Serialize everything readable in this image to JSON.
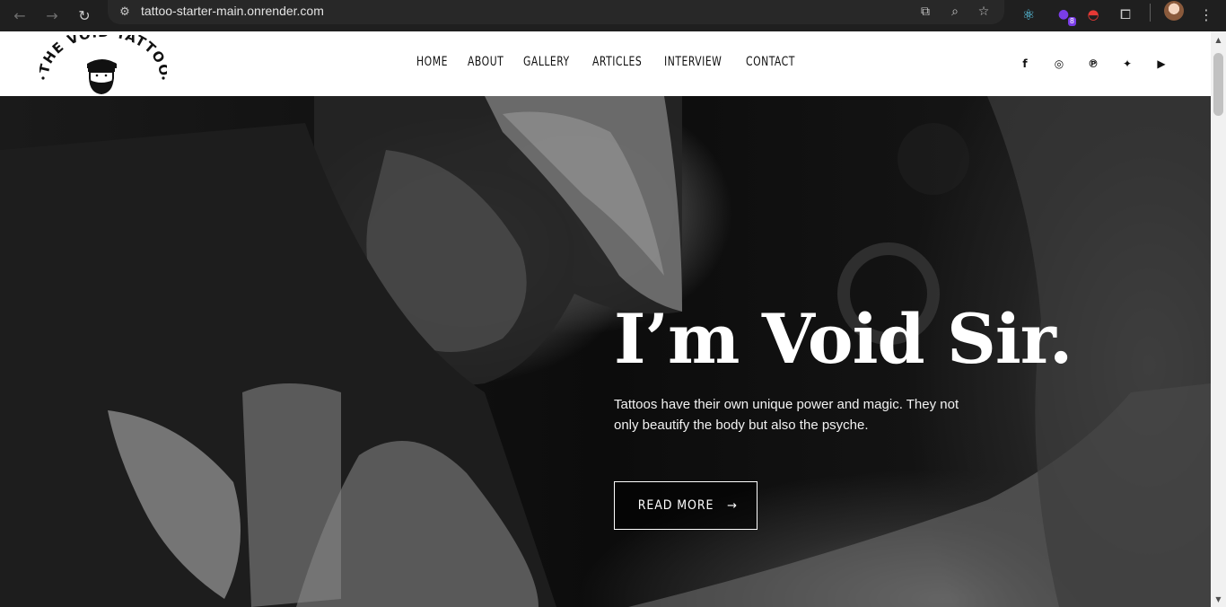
{
  "browser": {
    "url": "tattoo-starter-main.onrender.com",
    "back_icon": "arrow-left-icon",
    "forward_icon": "arrow-right-icon",
    "reload_icon": "reload-icon",
    "extension_badge": "8"
  },
  "site": {
    "logo_text": "THE VOID TATTOO",
    "nav": [
      {
        "label": "HOME"
      },
      {
        "label": "ABOUT"
      },
      {
        "label": "GALLERY"
      },
      {
        "label": "ARTICLES"
      },
      {
        "label": "INTERVIEW"
      },
      {
        "label": "CONTACT"
      }
    ],
    "socials": [
      {
        "icon": "facebook-icon",
        "glyph": "f"
      },
      {
        "icon": "instagram-icon",
        "glyph": "◎"
      },
      {
        "icon": "pinterest-icon",
        "glyph": "℗"
      },
      {
        "icon": "twitter-icon",
        "glyph": "✦"
      },
      {
        "icon": "youtube-icon",
        "glyph": "▶"
      }
    ]
  },
  "hero": {
    "title": "I’m Void Sir.",
    "text": "Tattoos have their own unique power and magic. They not only beautify the body but also the psyche.",
    "button_label": "READ MORE",
    "button_arrow": "→"
  },
  "colors": {
    "header_bg": "#ffffff",
    "hero_text": "#ffffff",
    "chrome_bg": "#1f1f1f"
  }
}
